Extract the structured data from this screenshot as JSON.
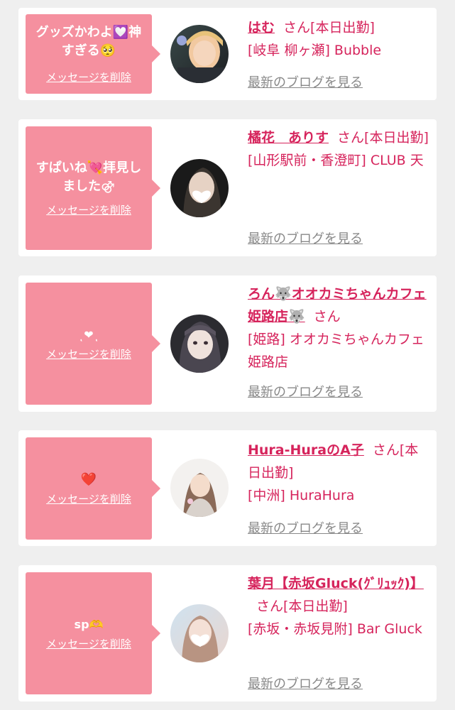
{
  "delete_label": "メッセージを削除",
  "blog_label": "最新のブログを見る",
  "colors": {
    "accent": "#d6245c",
    "bubble": "#f5909f",
    "link_gray": "#888888"
  },
  "items": [
    {
      "message": "グッズかわよ💟神すぎる🥺",
      "name": "はむ",
      "san": "さん",
      "status": "[本日出勤]",
      "shop": "[岐阜 柳ヶ瀬] Bubble"
    },
    {
      "message": "すぱいね💘拝見しました⚣",
      "name": "橘花　ありす",
      "san": "さん",
      "status": "[本日出勤]",
      "shop": "[山形駅前・香澄町] CLUB 天"
    },
    {
      "message": "ͺ❤ͺ",
      "name": "ろん🐺オオカミちゃんカフェ姫路店🐺",
      "san": "さん",
      "status": "",
      "shop": "[姫路] オオカミちゃんカフェ姫路店"
    },
    {
      "message": "❤️",
      "name": "Hura-HuraのA子",
      "san": "さん",
      "status": "[本日出勤]",
      "shop": "[中洲] HuraHura"
    },
    {
      "message": "sp🫶",
      "name": "葉月【赤坂Gluck(ｸﾞﾘｭｯｸ)】",
      "san": "さん",
      "status": "[本日出勤]",
      "shop": "[赤坂・赤坂見附] Bar Gluck"
    }
  ]
}
